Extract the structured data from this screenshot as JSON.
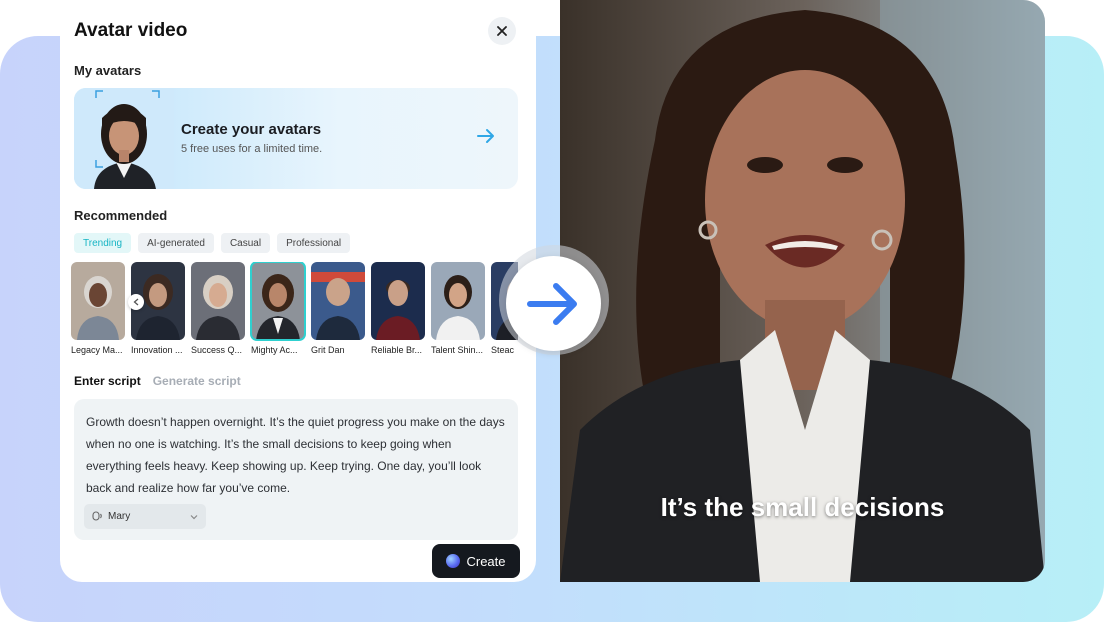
{
  "dialog": {
    "title": "Avatar video",
    "close_icon": "close-icon"
  },
  "my_avatars": {
    "label": "My avatars",
    "card_title": "Create your avatars",
    "card_subtitle": "5 free uses for a limited time."
  },
  "recommended": {
    "label": "Recommended",
    "chips": [
      "Trending",
      "AI-generated",
      "Casual",
      "Professional"
    ],
    "active_chip": "Trending",
    "avatars": [
      {
        "name": "Legacy Ma..."
      },
      {
        "name": "Innovation ..."
      },
      {
        "name": "Success Q..."
      },
      {
        "name": "Mighty Ac..."
      },
      {
        "name": "Grit Dan"
      },
      {
        "name": "Reliable Br..."
      },
      {
        "name": "Talent Shin..."
      },
      {
        "name": "Steac"
      }
    ],
    "selected_avatar": "Mighty Ac..."
  },
  "script": {
    "tabs": [
      "Enter script",
      "Generate script"
    ],
    "active_tab": "Enter script",
    "text": "Growth doesn’t happen overnight. It’s the quiet progress you make on the days when no one is watching. It’s the small decisions to keep going when everything feels heavy. Keep showing up. Keep trying. One day, you’ll look back and realize how far you’ve come.",
    "voice": "Mary"
  },
  "actions": {
    "create_label": "Create"
  },
  "preview": {
    "caption": "It’s the small decisions"
  },
  "colors": {
    "accent": "#17b5c4",
    "arrow": "#3b7cf0",
    "button": "#15191f"
  }
}
